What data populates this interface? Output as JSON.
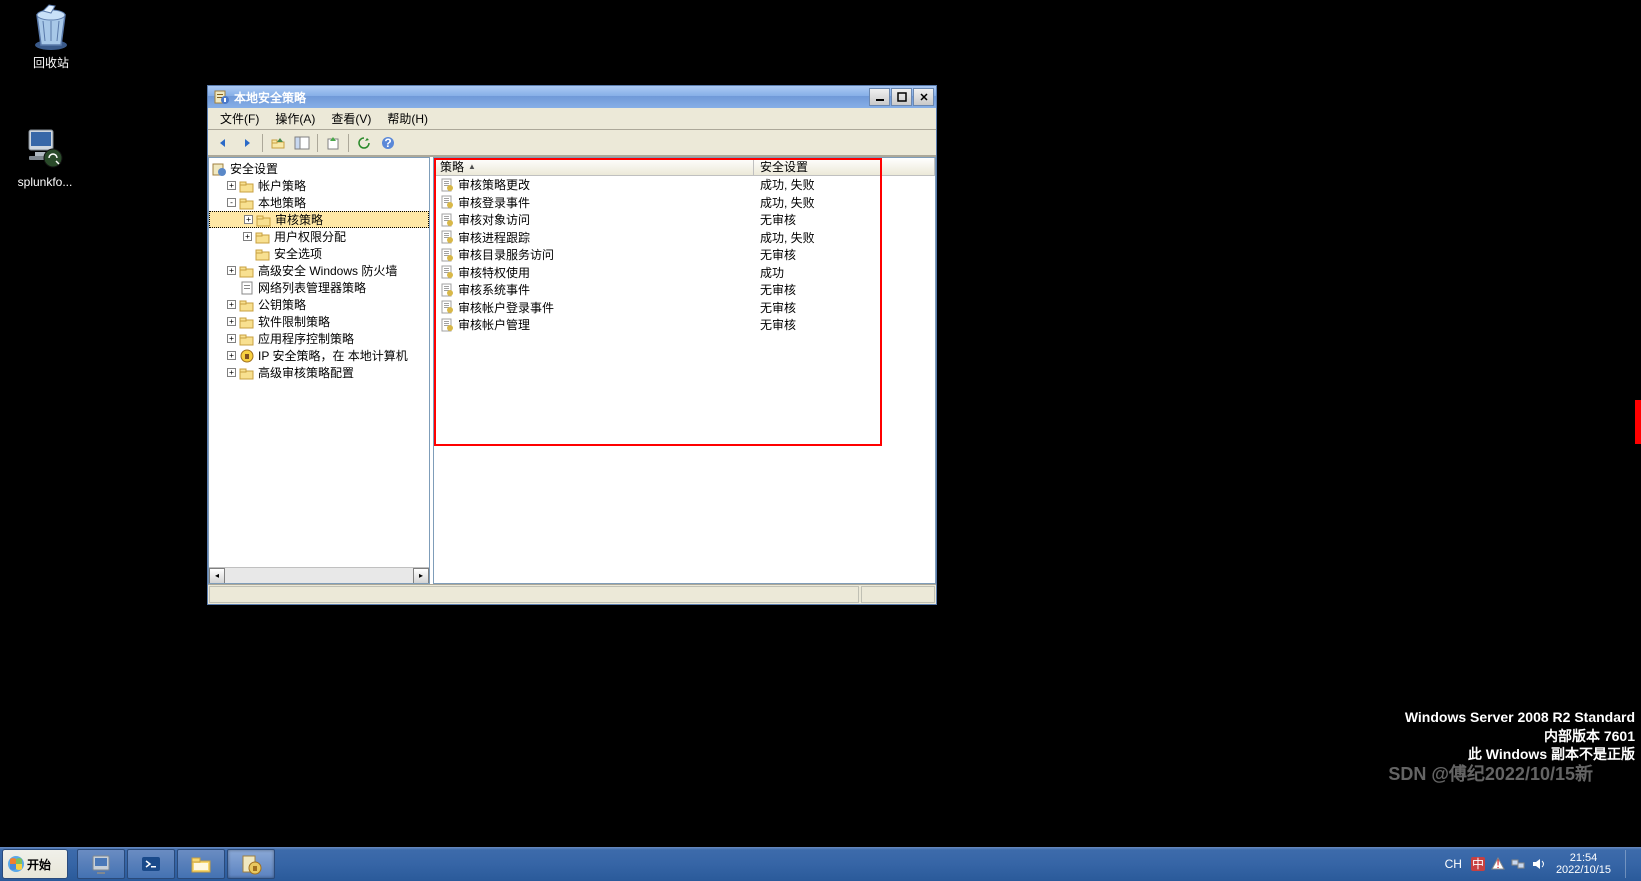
{
  "desktop": {
    "icons": [
      {
        "label": "回收站",
        "kind": "recycle-bin"
      },
      {
        "label": "splunkfo...",
        "kind": "app-splunk"
      }
    ]
  },
  "window": {
    "title": "本地安全策略",
    "menu": {
      "file": "文件(F)",
      "action": "操作(A)",
      "view": "查看(V)",
      "help": "帮助(H)"
    },
    "tree": {
      "root": "安全设置",
      "items": [
        {
          "label": "帐户策略",
          "icon": "folder",
          "exp": "+",
          "indent": 1
        },
        {
          "label": "本地策略",
          "icon": "folder",
          "exp": "-",
          "indent": 1
        },
        {
          "label": "审核策略",
          "icon": "folder",
          "exp": "+",
          "indent": 2,
          "selected": true
        },
        {
          "label": "用户权限分配",
          "icon": "folder",
          "exp": "+",
          "indent": 2
        },
        {
          "label": "安全选项",
          "icon": "folder",
          "exp": " ",
          "indent": 2
        },
        {
          "label": "高级安全 Windows 防火墙",
          "icon": "folder",
          "exp": "+",
          "indent": 1
        },
        {
          "label": "网络列表管理器策略",
          "icon": "doc",
          "exp": " ",
          "indent": 1
        },
        {
          "label": "公钥策略",
          "icon": "folder",
          "exp": "+",
          "indent": 1
        },
        {
          "label": "软件限制策略",
          "icon": "folder",
          "exp": "+",
          "indent": 1
        },
        {
          "label": "应用程序控制策略",
          "icon": "folder",
          "exp": "+",
          "indent": 1
        },
        {
          "label": "IP 安全策略，在 本地计算机",
          "icon": "ipsec",
          "exp": "+",
          "indent": 1
        },
        {
          "label": "高级审核策略配置",
          "icon": "folder",
          "exp": "+",
          "indent": 1
        }
      ]
    },
    "list": {
      "col_policy": "策略",
      "col_setting": "安全设置",
      "rows": [
        {
          "policy": "审核策略更改",
          "setting": "成功, 失败"
        },
        {
          "policy": "审核登录事件",
          "setting": "成功, 失败"
        },
        {
          "policy": "审核对象访问",
          "setting": "无审核"
        },
        {
          "policy": "审核进程跟踪",
          "setting": "成功, 失败"
        },
        {
          "policy": "审核目录服务访问",
          "setting": "无审核"
        },
        {
          "policy": "审核特权使用",
          "setting": "成功"
        },
        {
          "policy": "审核系统事件",
          "setting": "无审核"
        },
        {
          "policy": "审核帐户登录事件",
          "setting": "无审核"
        },
        {
          "policy": "审核帐户管理",
          "setting": "无审核"
        }
      ]
    }
  },
  "watermark": {
    "line1": "Windows Server 2008 R2 Standard",
    "line2": "内部版本 7601",
    "line3": "此 Windows 副本不是正版"
  },
  "csdn": "SDN @傅纪2022/10/15新",
  "taskbar": {
    "start": "开始",
    "lang": "CH",
    "time": "21:54",
    "date": "2022/10/15"
  }
}
